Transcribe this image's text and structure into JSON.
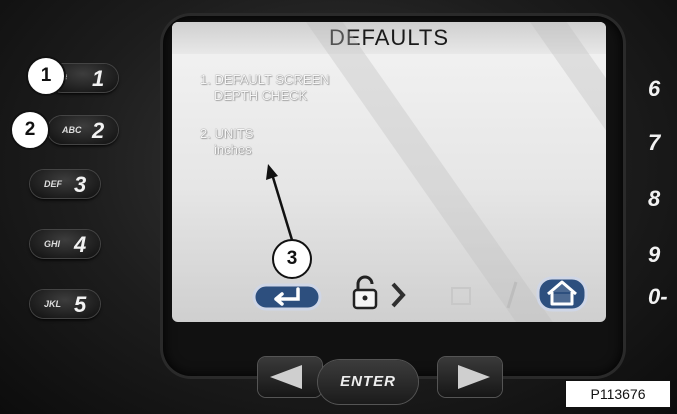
{
  "screen": {
    "title": "DEFAULTS",
    "items": [
      {
        "line1": "1. DEFAULT SCREEN",
        "line2": "DEPTH CHECK"
      },
      {
        "line1": "2. UNITS",
        "line2": "inches"
      }
    ],
    "softkeys": [
      "back-arrow-icon",
      "unlock-icon",
      "chevron-right-icon",
      "hidden-icon",
      "slash-icon",
      "home-icon"
    ]
  },
  "keypad_left": [
    {
      "letters": "#",
      "digit": "1"
    },
    {
      "letters": "ABC",
      "digit": "2"
    },
    {
      "letters": "DEF",
      "digit": "3"
    },
    {
      "letters": "GHI",
      "digit": "4"
    },
    {
      "letters": "JKL",
      "digit": "5"
    }
  ],
  "keypad_right": [
    "6",
    "7",
    "8",
    "9",
    "0-"
  ],
  "nav": {
    "enter_label": "ENTER"
  },
  "callouts": [
    "1",
    "2",
    "3"
  ],
  "figure_label": "P113676",
  "colors": {
    "screen_bg": "#e9e9e9",
    "console": "#1d1d1d",
    "callout_bg": "#ffffff"
  }
}
